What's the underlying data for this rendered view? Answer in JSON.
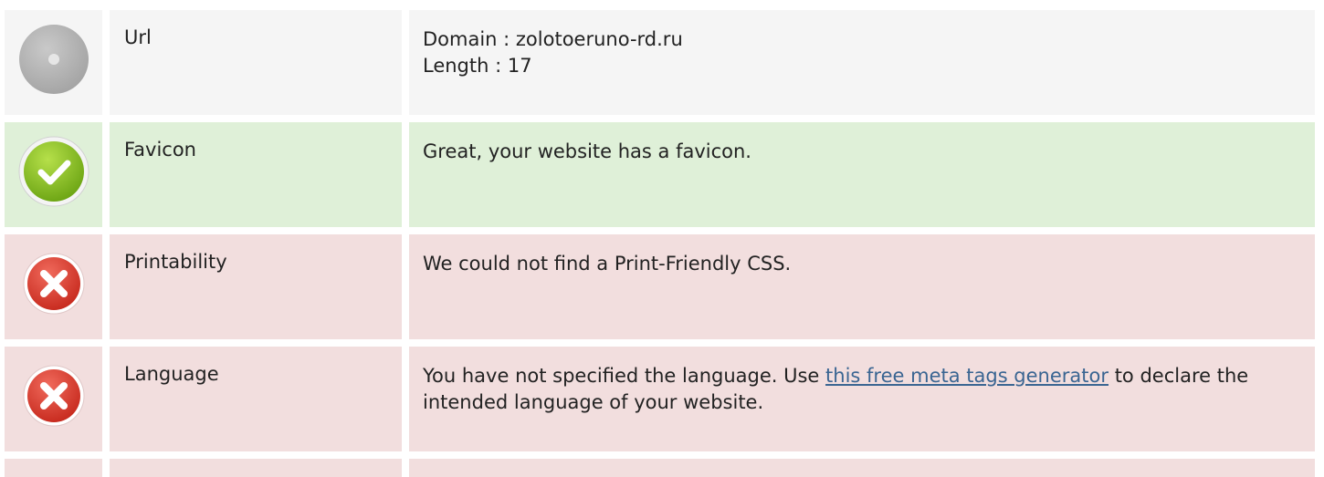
{
  "rows": [
    {
      "status": "neutral",
      "icon": "neutral-circle-icon",
      "label": "Url",
      "lines": [
        "Domain : zolotoeruno-rd.ru",
        "Length : 17"
      ]
    },
    {
      "status": "success",
      "icon": "check-circle-icon",
      "label": "Favicon",
      "text": "Great, your website has a favicon."
    },
    {
      "status": "error",
      "icon": "error-x-icon",
      "label": "Printability",
      "text": "We could not find a Print-Friendly CSS."
    },
    {
      "status": "error",
      "icon": "error-x-icon",
      "label": "Language",
      "text_before": "You have not specified the language. Use ",
      "link_text": "this free meta tags generator",
      "text_after": " to declare the intended language of your website."
    }
  ],
  "colors": {
    "neutral_bg": "#f5f5f5",
    "success_bg": "#dff0d8",
    "error_bg": "#f2dede",
    "link": "#3a6592"
  }
}
